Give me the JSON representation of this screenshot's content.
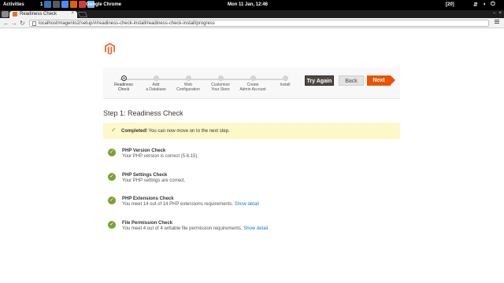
{
  "topbar": {
    "activities": "Activities",
    "workspace": "1",
    "app_name": "Google Chrome",
    "clock": "Mon 11 Jan, 12:46",
    "indicator": "[20]",
    "tray_icons": [
      "network-icon",
      "volume-icon",
      "power-icon"
    ],
    "launchers": [
      {
        "icon": "files-icon",
        "color": "#3d6fb6"
      },
      {
        "icon": "terminal-icon",
        "color": "#5a5a5a"
      },
      {
        "icon": "chrome-icon",
        "color": "#4c8bf5"
      },
      {
        "icon": "firefox-icon",
        "color": "#e66000"
      },
      {
        "icon": "mail-icon",
        "color": "#d23c3c"
      },
      {
        "icon": "chromium-icon",
        "color": "#7fb6e5"
      }
    ]
  },
  "browser": {
    "tab_title": "Readiness Check",
    "url": "localhost/magento2/setup/#/readiness-check-install/readiness-check-install/progress"
  },
  "wizard": {
    "steps": [
      {
        "label_line1": "Readiness",
        "label_line2": "Check",
        "active": true
      },
      {
        "label_line1": "Add",
        "label_line2": "a Database",
        "active": false
      },
      {
        "label_line1": "Web",
        "label_line2": "Configuration",
        "active": false
      },
      {
        "label_line1": "Customize",
        "label_line2": "Your Store",
        "active": false
      },
      {
        "label_line1": "Create",
        "label_line2": "Admin Account",
        "active": false
      },
      {
        "label_line1": "Install",
        "label_line2": "",
        "active": false
      }
    ],
    "buttons": {
      "try_again": "Try Again",
      "back": "Back",
      "next": "Next"
    }
  },
  "page": {
    "step_title": "Step 1: Readiness Check",
    "notice_strong": "Completed!",
    "notice_text": " You can now move on to the next step.",
    "checks": [
      {
        "title": "PHP Version Check",
        "desc": "Your PHP version is correct (5.6.15).",
        "link": ""
      },
      {
        "title": "PHP Settings Check",
        "desc": "Your PHP settings are correct.",
        "link": ""
      },
      {
        "title": "PHP Extensions Check",
        "desc": "You meet 14 out of 14 PHP extensions requirements.",
        "link": "Show detail"
      },
      {
        "title": "File Permission Check",
        "desc": "You meet 4 out of 4 writable file permission requirements.",
        "link": "Show detail"
      }
    ]
  },
  "colors": {
    "accent_orange": "#eb5202",
    "success_green": "#79a22e",
    "notice_yellow": "#fdf8c9",
    "link_blue": "#1979c3"
  }
}
